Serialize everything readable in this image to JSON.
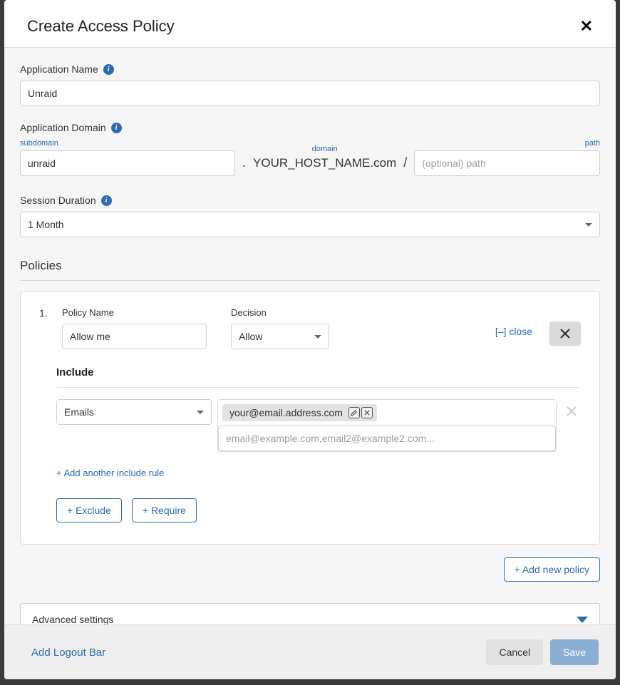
{
  "modal": {
    "title": "Create Access Policy"
  },
  "app_name": {
    "label": "Application Name",
    "value": "Unraid"
  },
  "app_domain": {
    "label": "Application Domain",
    "subdomain_label": "subdomain",
    "subdomain_value": "unraid",
    "domain_label": "domain",
    "domain_static": "YOUR_HOST_NAME.com",
    "path_label": "path",
    "path_placeholder": "(optional) path"
  },
  "session": {
    "label": "Session Duration",
    "value": "1 Month"
  },
  "policies": {
    "section_title": "Policies",
    "items": [
      {
        "index": "1.",
        "name_label": "Policy Name",
        "name_value": "Allow me",
        "decision_label": "Decision",
        "decision_value": "Allow",
        "toggle_label": "[–] close",
        "include_title": "Include",
        "include_type": "Emails",
        "chip_value": "your@email.address.com",
        "email_placeholder": "email@example.com,email2@example2.com...",
        "add_include_link": "+ Add another include rule",
        "exclude_btn": "+ Exclude",
        "require_btn": "+ Require"
      }
    ],
    "add_policy_label": "+ Add new policy"
  },
  "advanced": {
    "label": "Advanced settings"
  },
  "footer": {
    "logout_link": "Add Logout Bar",
    "cancel": "Cancel",
    "save": "Save"
  }
}
